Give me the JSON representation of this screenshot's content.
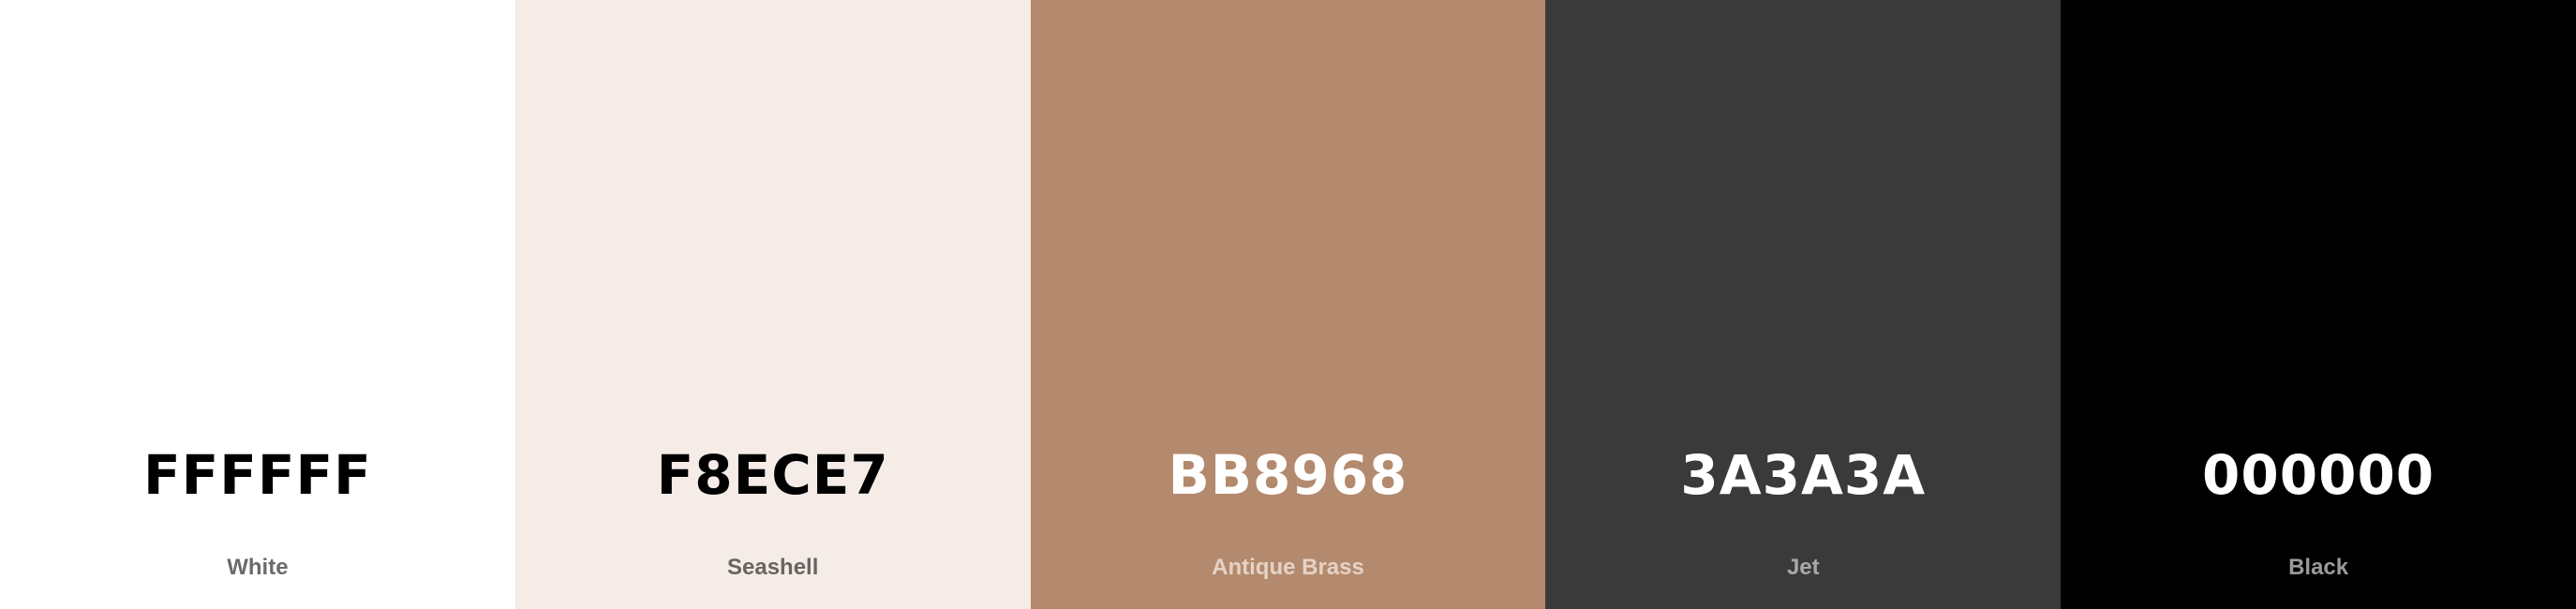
{
  "swatches": [
    {
      "hex": "FFFFFF",
      "name": "White",
      "bg": "#FFFFFF",
      "hex_color": "#000000",
      "name_color": "#6B6B6B"
    },
    {
      "hex": "F8ECE7",
      "name": "Seashell",
      "bg": "#F5ECE7",
      "hex_color": "#000000",
      "name_color": "#6B6361"
    },
    {
      "hex": "BB8968",
      "name": "Antique Brass",
      "bg": "#B38A6D",
      "hex_color": "#FFFFFF",
      "name_color": "#E6D2C6"
    },
    {
      "hex": "3A3A3A",
      "name": "Jet",
      "bg": "#3A3A3A",
      "hex_color": "#FFFFFF",
      "name_color": "#A8A8A8"
    },
    {
      "hex": "000000",
      "name": "Black",
      "bg": "#000000",
      "hex_color": "#FFFFFF",
      "name_color": "#9A9A9A"
    }
  ]
}
